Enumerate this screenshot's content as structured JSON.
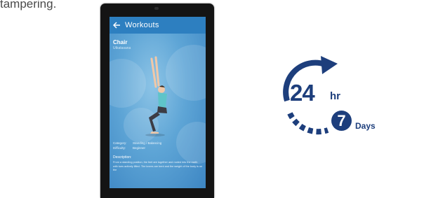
{
  "caption": "tampering.",
  "kiosk": {
    "app_title": "Workouts",
    "pose_name": "Chair",
    "pose_alt_name": "Utkatasana",
    "category_label": "Category:",
    "category_value": "Standing / Balancing",
    "difficulty_label": "Difficulty:",
    "difficulty_value": "Beginner",
    "description_heading": "Description:",
    "description_text": "From a standing position, the feet are together and rooted into the earth with toes actively lifted. The knees are bent and the weight of the body is on the"
  },
  "badge": {
    "hours_number": "24",
    "hours_unit": "hr",
    "days_number": "7",
    "days_label": "Days",
    "color": "#1d3e7c"
  },
  "colors": {
    "app_bar": "#2d7fc0",
    "screen": "#5ea5d6"
  },
  "icons": {
    "back": "arrow-left-icon",
    "clock_arrow": "circular-arrow-icon"
  }
}
